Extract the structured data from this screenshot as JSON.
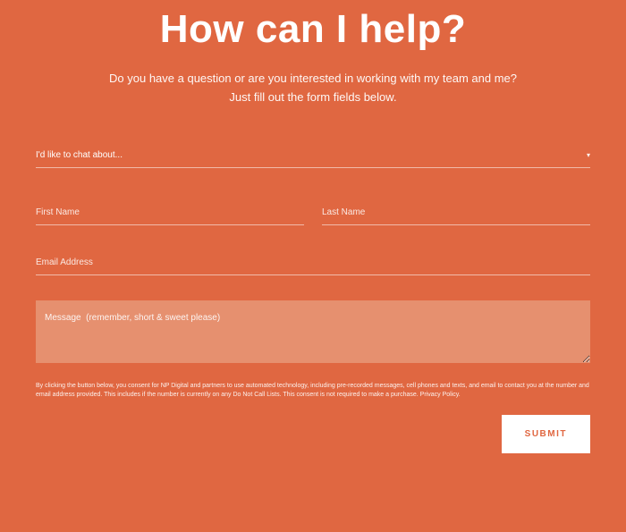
{
  "heading": "How can I help?",
  "subtext_line1": "Do you have a question or are you interested in working with my team and me?",
  "subtext_line2": "Just fill out the form fields below.",
  "form": {
    "topic_placeholder": "I'd like to chat about...",
    "first_name_placeholder": "First Name",
    "last_name_placeholder": "Last Name",
    "email_placeholder": "Email Address",
    "message_placeholder": "Message  (remember, short & sweet please)",
    "disclaimer": "By clicking the button below, you consent for NP Digital and partners to use automated technology, including pre-recorded messages, cell phones and texts, and email to contact you at the number and email address provided. This includes if the number is currently on any Do Not Call Lists. This consent is not required to make a purchase. Privacy Policy.",
    "submit_label": "SUBMIT"
  }
}
